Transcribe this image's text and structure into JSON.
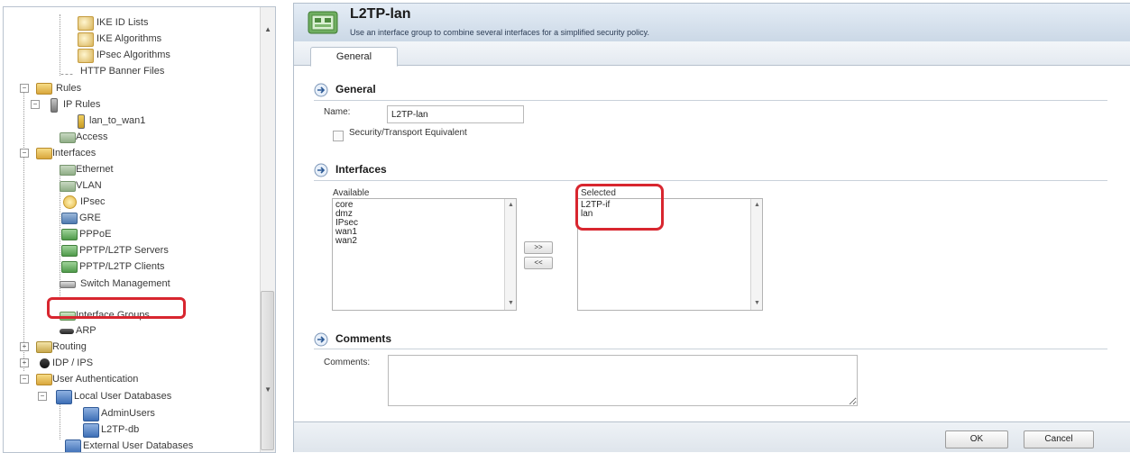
{
  "tree": {
    "items": [
      {
        "label": "IKE ID Lists"
      },
      {
        "label": "IKE Algorithms"
      },
      {
        "label": "IPsec Algorithms"
      },
      {
        "label": "HTTP Banner Files"
      },
      {
        "label": "Rules"
      },
      {
        "label": "IP Rules"
      },
      {
        "label": "lan_to_wan1"
      },
      {
        "label": "Access"
      },
      {
        "label": "Interfaces"
      },
      {
        "label": "Ethernet"
      },
      {
        "label": "VLAN"
      },
      {
        "label": "IPsec"
      },
      {
        "label": "GRE"
      },
      {
        "label": "PPPoE"
      },
      {
        "label": "PPTP/L2TP Servers"
      },
      {
        "label": "PPTP/L2TP Clients"
      },
      {
        "label": "Switch Management"
      },
      {
        "label": "Interface Groups"
      },
      {
        "label": "ARP"
      },
      {
        "label": "Routing"
      },
      {
        "label": "IDP / IPS"
      },
      {
        "label": "User Authentication"
      },
      {
        "label": "Local User Databases"
      },
      {
        "label": "AdminUsers"
      },
      {
        "label": "L2TP-db"
      },
      {
        "label": "External User Databases"
      }
    ]
  },
  "header": {
    "title": "L2TP-lan",
    "subtitle": "Use an interface group to combine several interfaces for a simplified security policy."
  },
  "tabs": [
    {
      "label": "General"
    }
  ],
  "general": {
    "section_title": "General",
    "name_label": "Name:",
    "name_value": "L2TP-lan",
    "checkbox_label": "Security/Transport Equivalent"
  },
  "interfaces": {
    "section_title": "Interfaces",
    "available_label": "Available",
    "available": [
      "core",
      "dmz",
      "IPsec",
      "wan1",
      "wan2"
    ],
    "selected_label": "Selected",
    "selected": [
      "L2TP-if",
      "lan"
    ],
    "add_button": ">>",
    "remove_button": "<<"
  },
  "comments": {
    "section_title": "Comments",
    "label": "Comments:",
    "value": ""
  },
  "footer": {
    "ok": "OK",
    "cancel": "Cancel"
  }
}
